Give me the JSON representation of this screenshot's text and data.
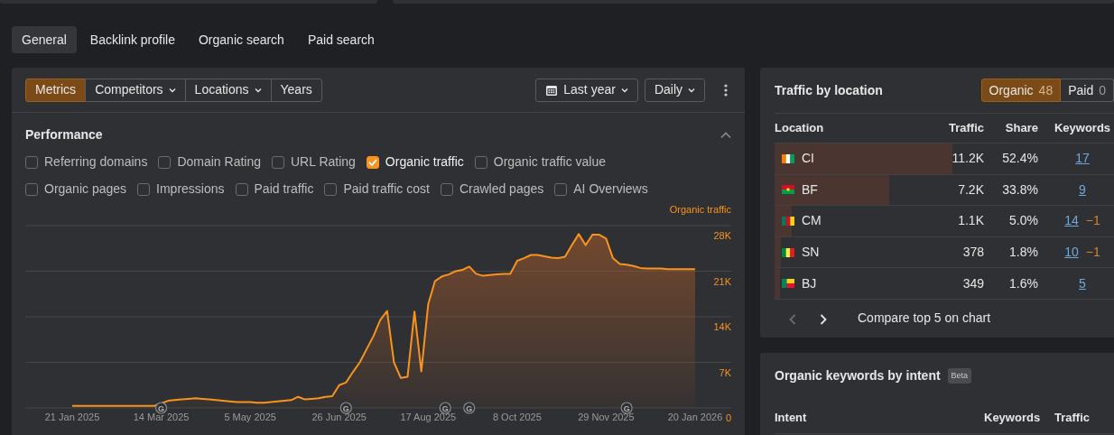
{
  "tabs": [
    {
      "label": "General",
      "selected": true
    },
    {
      "label": "Backlink profile",
      "selected": false
    },
    {
      "label": "Organic search",
      "selected": false
    },
    {
      "label": "Paid search",
      "selected": false
    }
  ],
  "toolbar": {
    "segments": [
      {
        "label": "Metrics",
        "selected": true,
        "dropdown": false
      },
      {
        "label": "Competitors",
        "selected": false,
        "dropdown": true
      },
      {
        "label": "Locations",
        "selected": false,
        "dropdown": true
      },
      {
        "label": "Years",
        "selected": false,
        "dropdown": false
      }
    ],
    "period": "Last year",
    "interval": "Daily"
  },
  "performance": {
    "title": "Performance",
    "expanded": true,
    "metric_rows": [
      [
        {
          "label": "Referring domains",
          "checked": false
        },
        {
          "label": "Domain Rating",
          "checked": false
        },
        {
          "label": "URL Rating",
          "checked": false
        },
        {
          "label": "Organic traffic",
          "checked": true
        },
        {
          "label": "Organic traffic value",
          "checked": false
        }
      ],
      [
        {
          "label": "Organic pages",
          "checked": false
        },
        {
          "label": "Impressions",
          "checked": false
        },
        {
          "label": "Paid traffic",
          "checked": false
        },
        {
          "label": "Paid traffic cost",
          "checked": false
        },
        {
          "label": "Crawled pages",
          "checked": false
        },
        {
          "label": "AI Overviews",
          "checked": false
        }
      ]
    ],
    "chart_data": {
      "type": "area",
      "grid": true,
      "ylim": [
        0,
        28000
      ],
      "yticks": [
        {
          "value": 0,
          "label": "0"
        },
        {
          "value": 7000,
          "label": "7K"
        },
        {
          "value": 14000,
          "label": "14K"
        },
        {
          "value": 21000,
          "label": "21K"
        },
        {
          "value": 28000,
          "label": "28K"
        }
      ],
      "categories": [
        "21 Jan 2025",
        null,
        null,
        null,
        null,
        null,
        null,
        null,
        null,
        null,
        null,
        null,
        null,
        "14 Mar 2025",
        null,
        null,
        null,
        null,
        null,
        null,
        null,
        null,
        null,
        null,
        null,
        null,
        "5 May 2025",
        null,
        null,
        null,
        null,
        null,
        null,
        null,
        null,
        null,
        null,
        null,
        null,
        "26 Jun 2025",
        null,
        null,
        null,
        null,
        null,
        null,
        null,
        null,
        null,
        null,
        null,
        null,
        "17 Aug 2025",
        null,
        null,
        null,
        null,
        null,
        null,
        null,
        null,
        null,
        null,
        null,
        null,
        "8 Oct 2025",
        null,
        null,
        null,
        null,
        null,
        null,
        null,
        null,
        null,
        null,
        null,
        null,
        "29 Nov 2025",
        null,
        null,
        null,
        null,
        null,
        null,
        null,
        null,
        null,
        null,
        null,
        null,
        "20 Jan 2026"
      ],
      "series": [
        {
          "name": "Organic traffic",
          "color": "#f7931e",
          "values": [
            300,
            300,
            300,
            300,
            300,
            300,
            300,
            300,
            300,
            300,
            300,
            300,
            300,
            null,
            1100,
            1200,
            1300,
            1400,
            1500,
            1400,
            1300,
            1200,
            1100,
            1000,
            900,
            900,
            900,
            800,
            800,
            900,
            1000,
            1100,
            1200,
            1700,
            1300,
            1400,
            1500,
            1700,
            1800,
            3500,
            3900,
            5500,
            7000,
            9000,
            11000,
            13500,
            14900,
            7000,
            4600,
            4800,
            14800,
            5600,
            15900,
            19500,
            20200,
            20500,
            21000,
            21200,
            21700,
            20600,
            20300,
            20400,
            20500,
            20600,
            20600,
            22600,
            23000,
            23500,
            23500,
            23300,
            23100,
            23000,
            23200,
            25000,
            26700,
            25000,
            26600,
            26600,
            26000,
            23000,
            22100,
            22000,
            21800,
            21500,
            21400,
            21400,
            21400,
            21300,
            21300,
            21300,
            21300,
            21300
          ]
        }
      ]
    },
    "update_markers": [
      {
        "text": "G"
      },
      {
        "text": "G"
      },
      {
        "text": "G"
      },
      {
        "text": "G"
      },
      {
        "text": "G"
      }
    ]
  },
  "traffic_by_location": {
    "title": "Traffic by location",
    "toggle": [
      {
        "label": "Organic",
        "count": "48",
        "selected": true
      },
      {
        "label": "Paid",
        "count": "0",
        "selected": false
      }
    ],
    "columns": [
      "Location",
      "Traffic",
      "Share",
      "Keywords"
    ],
    "rows": [
      {
        "kind": "ci",
        "location": "CI",
        "traffic": "11.2K",
        "share": "52.4%",
        "keywords": "17",
        "level": 0.524
      },
      {
        "kind": "bf",
        "location": "BF",
        "traffic": "7.2K",
        "share": "33.8%",
        "keywords": "9",
        "level": 0.338
      },
      {
        "kind": "cm",
        "location": "CM",
        "traffic": "1.1K",
        "share": "5.0%",
        "keywords": "14",
        "change": "−1",
        "level": 0.05
      },
      {
        "kind": "sn",
        "location": "SN",
        "traffic": "378",
        "share": "1.8%",
        "keywords": "10",
        "change": "−1",
        "level": 0.018
      },
      {
        "kind": "bj",
        "location": "BJ",
        "traffic": "349",
        "share": "1.6%",
        "keywords": "5",
        "level": 0.016
      }
    ],
    "prev_disabled": true,
    "next_disabled": false,
    "compare": "Compare top 5 on chart"
  },
  "keywords_by_intent": {
    "title": "Organic keywords by intent",
    "badge": "Beta",
    "columns": [
      "Intent",
      "Keywords",
      "Traffic"
    ]
  }
}
